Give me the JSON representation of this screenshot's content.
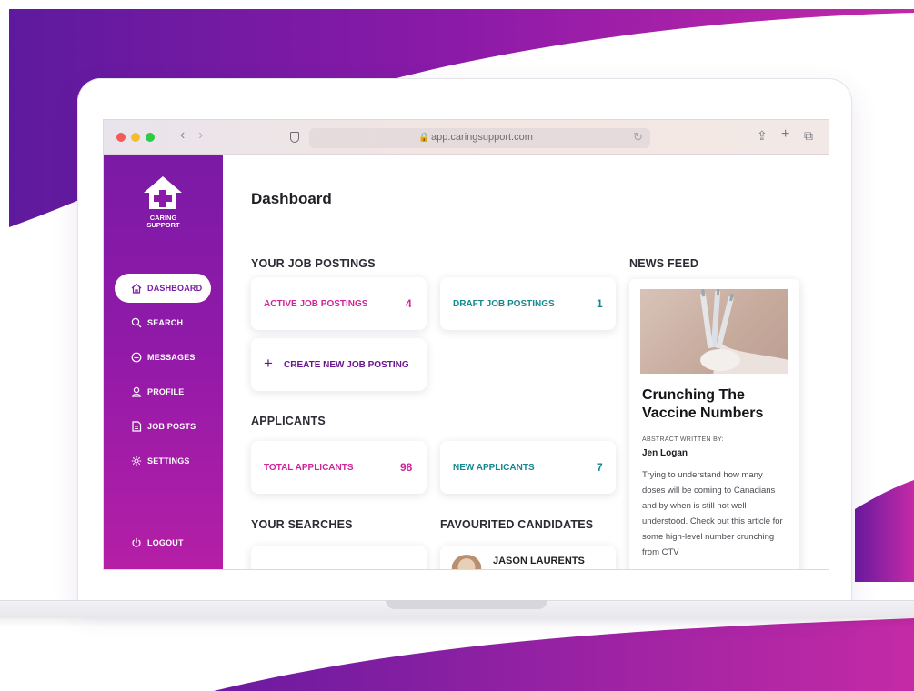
{
  "browser": {
    "url": "app.caringsupport.com"
  },
  "brand": {
    "line1": "CARING",
    "line2": "SUPPORT",
    "primary_color": "#7a1aa6",
    "accent_color": "#d0249a",
    "teal_color": "#15888f"
  },
  "sidebar": {
    "items": [
      {
        "label": "DASHBOARD",
        "icon": "home-icon",
        "active": true
      },
      {
        "label": "SEARCH",
        "icon": "search-icon",
        "active": false
      },
      {
        "label": "MESSAGES",
        "icon": "chat-icon",
        "active": false
      },
      {
        "label": "PROFILE",
        "icon": "user-icon",
        "active": false
      },
      {
        "label": "JOB POSTS",
        "icon": "document-icon",
        "active": false
      },
      {
        "label": "SETTINGS",
        "icon": "gear-icon",
        "active": false
      }
    ],
    "logout_label": "LOGOUT"
  },
  "main": {
    "title": "Dashboard",
    "job_postings": {
      "heading": "YOUR JOB POSTINGS",
      "active_label": "ACTIVE JOB POSTINGS",
      "active_count": "4",
      "draft_label": "DRAFT JOB POSTINGS",
      "draft_count": "1",
      "create_label": "CREATE NEW JOB POSTING"
    },
    "applicants": {
      "heading": "APPLICANTS",
      "total_label": "TOTAL APPLICANTS",
      "total_count": "98",
      "new_label": "NEW APPLICANTS",
      "new_count": "7"
    },
    "searches": {
      "heading": "YOUR SEARCHES"
    },
    "favourites": {
      "heading": "FAVOURITED CANDIDATES",
      "candidate_name": "JASON LAURENTS"
    }
  },
  "news": {
    "heading": "NEWS FEED",
    "headline": "Crunching The Vaccine Numbers",
    "byline": "ABSTRACT WRITTEN BY:",
    "author": "Jen Logan",
    "body": "Trying to understand how many doses will be coming to Canadians and by when is still not well understood. Check out this article for some high-level number crunching from CTV"
  }
}
